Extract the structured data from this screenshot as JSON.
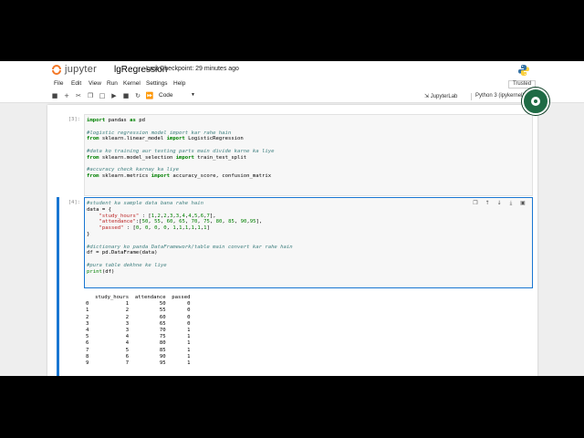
{
  "header": {
    "logo_text": "jupyter",
    "notebook_name": "lgRegression",
    "checkpoint": "Last Checkpoint: 29 minutes ago",
    "python_logo_icon": "python-logo"
  },
  "menubar": {
    "items": [
      "File",
      "Edit",
      "View",
      "Run",
      "Kernel",
      "Settings",
      "Help"
    ],
    "trusted": "Trusted"
  },
  "toolbar": {
    "buttons": [
      "save-icon",
      "plus-icon",
      "cut-icon",
      "copy-icon",
      "paste-icon",
      "run-icon",
      "stop-icon",
      "restart-icon",
      "fast-forward-icon"
    ],
    "cell_type": "Code",
    "jupyterlab_label": "JupyterLab",
    "kernel_label": "Python 3 (ipykernel)"
  },
  "cells": {
    "cell1_prompt": "[3]:",
    "cell1_lines": [
      "import pandas as pd",
      "",
      "#logistic regression model import kar rahe hain",
      "from sklearn.linear_model import LogisticRegression",
      "",
      "#data ko training aur testing parts main divide karne ka liye",
      "from sklearn.model_selection import train_test_split",
      "",
      "#accuracy check karnay ka liye",
      "from sklearn.metrics import accuracy_score, confusion_matrix"
    ],
    "cell2_prompt": "[4]:",
    "cell2_lines": [
      "#student ka sample data bana rahe hain",
      "data = {",
      "    \"study_hours\" : [1,2,2,3,3,4,4,5,6,7],",
      "    \"attendance\":[50, 55, 60, 65, 70, 75, 80, 85, 90,95],",
      "    \"passed\" : [0, 0, 0, 0, 1,1,1,1,1,1]",
      "}",
      "",
      "#dictionary ko panda DataFramework/table main convert kar rahe hain",
      "df = pd.DataFrame(data)",
      "",
      "#pura table dekhne ke liye",
      "print(df)"
    ],
    "df_header": "   study_hours  attendance  passed",
    "df_rows": [
      "0            1          50       0",
      "1            2          55       0",
      "2            2          60       0",
      "3            3          65       0",
      "4            3          70       1",
      "5            4          75       1",
      "6            4          80       1",
      "7            5          85       1",
      "8            6          90       1",
      "9            7          95       1"
    ]
  }
}
